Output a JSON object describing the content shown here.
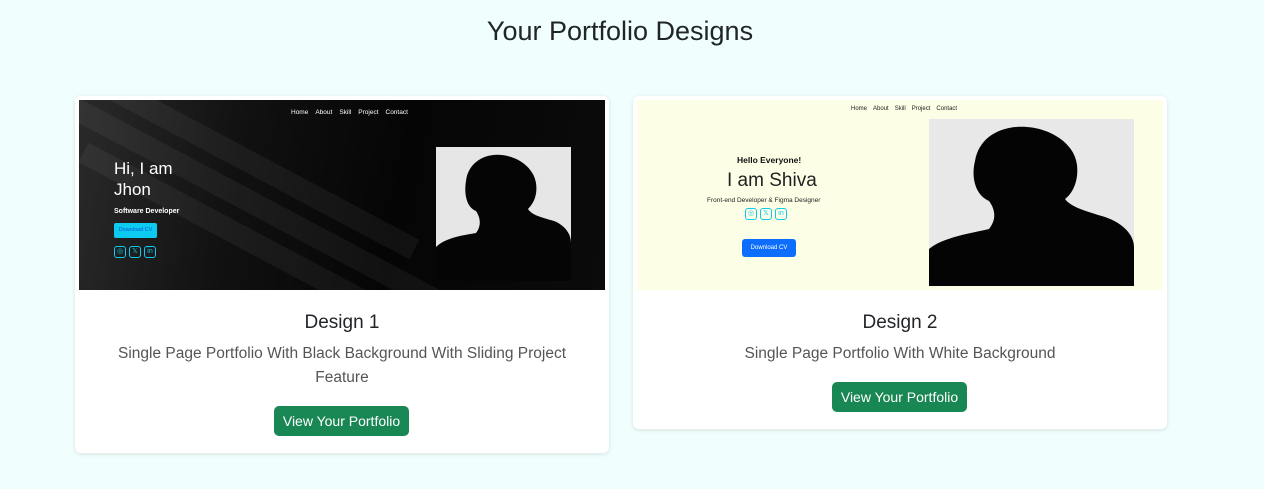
{
  "page": {
    "title": "Your Portfolio Designs"
  },
  "cards": [
    {
      "title": "Design 1",
      "description": "Single Page Portfolio With Black Background With Sliding Project Feature",
      "button_label": "View Your Portfolio",
      "preview": {
        "nav": [
          "Home",
          "About",
          "Skill",
          "Project",
          "Contact"
        ],
        "greeting_line1": "Hi, I am",
        "greeting_line2": "Jhon",
        "role": "Software Developer",
        "download": "Download CV",
        "social": [
          "instagram-icon",
          "x-icon",
          "linkedin-icon"
        ]
      }
    },
    {
      "title": "Design 2",
      "description": "Single Page Portfolio With White Background",
      "button_label": "View Your Portfolio",
      "preview": {
        "nav": [
          "Home",
          "About",
          "Skill",
          "Project",
          "Contact"
        ],
        "hello": "Hello Everyone!",
        "name": "I am Shiva",
        "role": "Front-end Developer & Figma Designer",
        "download": "Download CV",
        "social": [
          "instagram-icon",
          "x-icon",
          "linkedin-icon"
        ]
      }
    }
  ],
  "colors": {
    "page_background": "#f0fffd",
    "button": "#198754",
    "accent_cyan": "#0dcaf0",
    "accent_blue": "#0d6efd",
    "design2_background": "#fdfee6"
  }
}
